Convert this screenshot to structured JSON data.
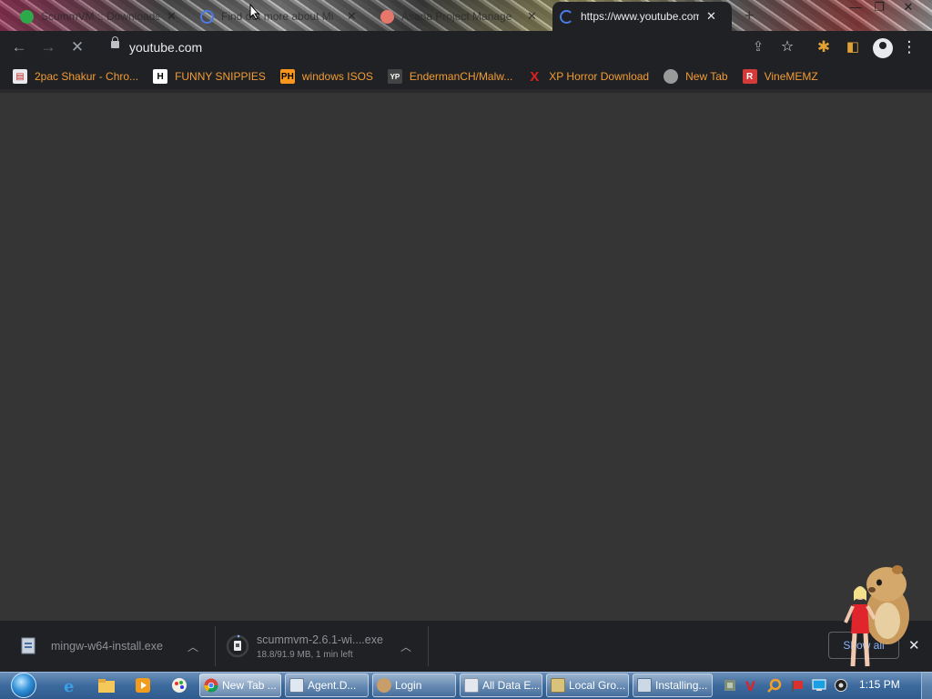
{
  "tabs": [
    {
      "title": "ScummVM :: Downloads",
      "favicon": "scummvm-icon",
      "active": false
    },
    {
      "title": "Find out more about Mi",
      "favicon": "loading-icon",
      "active": false
    },
    {
      "title": "Asana Project Manage",
      "favicon": "asana-icon",
      "active": false
    },
    {
      "title": "https://www.youtube.com",
      "favicon": "loading-spinner-icon",
      "active": true
    }
  ],
  "toolbar": {
    "url": "youtube.com"
  },
  "bookmarks": [
    {
      "label": "2pac Shakur - Chro...",
      "icon": "chrome-store-icon",
      "icon_text": "",
      "icon_color": "#e8eaed"
    },
    {
      "label": "FUNNY SNIPPIES",
      "icon": "h-icon",
      "icon_text": "H",
      "icon_color": "#ffffff"
    },
    {
      "label": "windows ISOS",
      "icon": "ph-icon",
      "icon_text": "PH",
      "icon_color": "#f7971d"
    },
    {
      "label": "EndermanCH/Malw...",
      "icon": "yp-icon",
      "icon_text": "YP",
      "icon_color": "#444444"
    },
    {
      "label": "XP Horror Download",
      "icon": "red-x-icon",
      "icon_text": "X",
      "icon_color": "#e02020"
    },
    {
      "label": "New Tab",
      "icon": "globe-icon",
      "icon_text": "",
      "icon_color": "#9a9a9a"
    },
    {
      "label": "VineMEMZ",
      "icon": "r-icon",
      "icon_text": "R",
      "icon_color": "#d43a3a"
    }
  ],
  "downloads": [
    {
      "name": "mingw-w64-install.exe",
      "status": ""
    },
    {
      "name": "scummvm-2.6.1-wi....exe",
      "status": "18.8/91.9 MB, 1 min left"
    }
  ],
  "shelf": {
    "show_all": "Show all"
  },
  "taskbar": {
    "items": [
      {
        "label": "New Tab ...",
        "icon": "chrome-icon",
        "active": true
      },
      {
        "label": "Agent.D...",
        "icon": "window-icon",
        "active": false
      },
      {
        "label": "Login",
        "icon": "user-icon",
        "active": false
      },
      {
        "label": "All Data E...",
        "icon": "folder-icon",
        "active": false
      },
      {
        "label": "Local Gro...",
        "icon": "policy-icon",
        "active": false
      },
      {
        "label": "Installing...",
        "icon": "installer-icon",
        "active": false
      }
    ],
    "clock": "1:15 PM"
  },
  "colors": {
    "chrome_dark": "#202124",
    "page_bg": "#353535",
    "bookmark_text": "#f29c35",
    "taskbar": "#3d6a9e"
  }
}
